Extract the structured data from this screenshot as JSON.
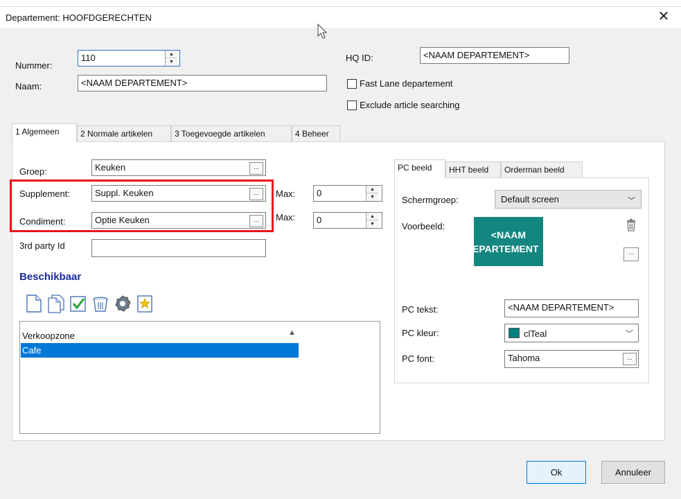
{
  "window": {
    "title": "Departement: HOOFDGERECHTEN",
    "close_symbol": "✕"
  },
  "header": {
    "nummer_label": "Nummer:",
    "nummer_value": "110",
    "naam_label": "Naam:",
    "naam_value": "<NAAM DEPARTEMENT>",
    "hqid_label": "HQ ID:",
    "hqid_value": "<NAAM DEPARTEMENT>",
    "fastlane_label": "Fast Lane departement",
    "exclude_label": "Exclude article searching"
  },
  "tabs": [
    {
      "label": "1 Algemeen"
    },
    {
      "label": "2 Normale artikelen"
    },
    {
      "label": "3 Toegevoegde artikelen"
    },
    {
      "label": "4 Beheer"
    }
  ],
  "general": {
    "groep_label": "Groep:",
    "groep_value": "Keuken",
    "supplement_label": "Supplement:",
    "supplement_value": "Suppl. Keuken",
    "condiment_label": "Condiment:",
    "condiment_value": "Optie Keuken",
    "max_label": "Max:",
    "supplement_max": "0",
    "condiment_max": "0",
    "thirdparty_label": "3rd party Id",
    "thirdparty_value": "",
    "highlight_color": "#e8141c"
  },
  "beschikbaar": {
    "title": "Beschikbaar",
    "title_color": "#1a2a9c",
    "toolbar_icons": [
      "new-doc-icon",
      "copy-doc-icon",
      "check-icon",
      "trash-icon",
      "gear-icon",
      "star-doc-icon"
    ],
    "column_header": "Verkoopzone",
    "sort_symbol": "▲",
    "rows": [
      {
        "name": "Cafe",
        "selected": true
      }
    ],
    "selection_color": "#0078d7"
  },
  "pc_panel": {
    "tabs": [
      {
        "label": "PC beeld"
      },
      {
        "label": "HHT beeld"
      },
      {
        "label": "Orderman beeld"
      }
    ],
    "schermgroep_label": "Schermgroep:",
    "schermgroep_value": "Default screen",
    "voorbeeld_label": "Voorbeeld:",
    "preview_line1": "<NAAM",
    "preview_line2": "EPARTEMENT",
    "preview_bg": "#12867f",
    "pctekst_label": "PC tekst:",
    "pctekst_value": "<NAAM DEPARTEMENT>",
    "pckleur_label": "PC kleur:",
    "pckleur_value": "clTeal",
    "pckleur_swatch": "#008080",
    "pcfont_label": "PC font:",
    "pcfont_value": "Tahoma"
  },
  "buttons": {
    "ok": "Ok",
    "cancel": "Annuleer"
  }
}
